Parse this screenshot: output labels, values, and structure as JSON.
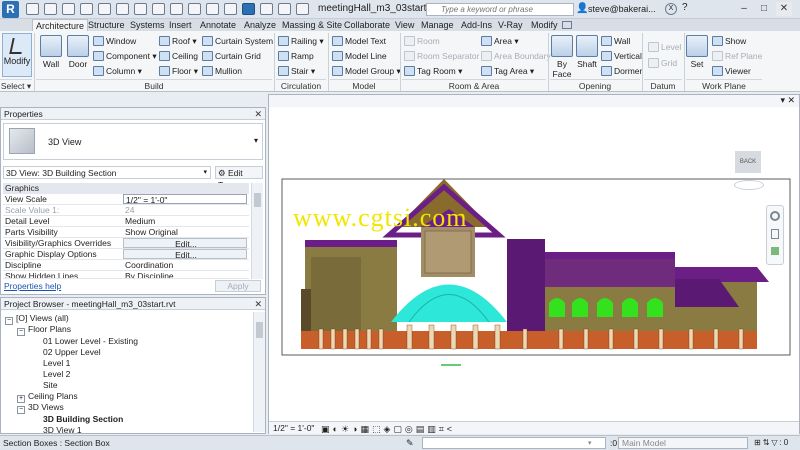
{
  "titlebar": {
    "doc_title": "meetingHall_m3_03start.rv...",
    "search_placeholder": "Type a keyword or phrase",
    "user": "steve@bakerai..."
  },
  "tabs": [
    "Architecture",
    "Structure",
    "Systems",
    "Insert",
    "Annotate",
    "Analyze",
    "Massing & Site",
    "Collaborate",
    "View",
    "Manage",
    "Add-Ins",
    "V-Ray",
    "Modify"
  ],
  "ribbon": {
    "modify": "Modify",
    "select": "Select",
    "wall": "Wall",
    "door": "Door",
    "window": "Window",
    "component": "Component",
    "column": "Column",
    "roof": "Roof",
    "ceiling": "Ceiling",
    "floor": "Floor",
    "curtain_system": "Curtain System",
    "curtain_grid": "Curtain Grid",
    "mullion": "Mullion",
    "build": "Build",
    "railing": "Railing",
    "ramp": "Ramp",
    "stair": "Stair",
    "circulation": "Circulation",
    "model_text": "Model Text",
    "model_line": "Model Line",
    "model_group": "Model Group",
    "model": "Model",
    "room": "Room",
    "room_separator": "Room Separator",
    "tag_room": "Tag Room",
    "area": "Area",
    "area_boundary": "Area Boundary",
    "tag_area": "Tag Area",
    "room_area": "Room & Area",
    "by_face": "By Face",
    "shaft": "Shaft",
    "wall_op": "Wall",
    "vertical": "Vertical",
    "dormer": "Dormer",
    "opening": "Opening",
    "level": "Level",
    "grid": "Grid",
    "datum": "Datum",
    "set": "Set",
    "show": "Show",
    "ref_plane": "Ref Plane",
    "viewer": "Viewer",
    "work_plane": "Work Plane"
  },
  "properties": {
    "title": "Properties",
    "type_name": "3D View",
    "view_selector": "3D View: 3D Building Section",
    "edit_type": "Edit Type",
    "group": "Graphics",
    "rows": [
      {
        "k": "View Scale",
        "v": "1/2\" = 1'-0\""
      },
      {
        "k": "Scale Value    1:",
        "v": "24"
      },
      {
        "k": "Detail Level",
        "v": "Medium"
      },
      {
        "k": "Parts Visibility",
        "v": "Show Original"
      },
      {
        "k": "Visibility/Graphics Overrides",
        "v": "Edit..."
      },
      {
        "k": "Graphic Display Options",
        "v": "Edit..."
      },
      {
        "k": "Discipline",
        "v": "Coordination"
      },
      {
        "k": "Show Hidden Lines",
        "v": "By Discipline"
      }
    ],
    "help": "Properties help",
    "apply": "Apply"
  },
  "browser": {
    "title": "Project Browser - meetingHall_m3_03start.rvt",
    "views_all": "Views (all)",
    "floor_plans": "Floor Plans",
    "fp_items": [
      "01 Lower Level - Existing",
      "02 Upper Level",
      "Level 1",
      "Level 2",
      "Site"
    ],
    "ceiling_plans": "Ceiling Plans",
    "views_3d": "3D Views",
    "v3d_items": [
      "3D Building Section",
      "3D View 1"
    ]
  },
  "view": {
    "watermark": "www.cgtsi.com",
    "viewcube": "BACK",
    "scale": "1/2\" = 1'-0\""
  },
  "status": {
    "text": "Section Boxes : Section Box",
    "zero": ":0",
    "model": "Main Model"
  },
  "colors": {
    "roof_purple": "#6b1f86",
    "glass_green": "#33e21c",
    "dome_cyan": "#2de8d9",
    "brick_brown": "#c85f2b",
    "wall_olive": "#8a7b43",
    "tower_tan": "#a38d66",
    "watermark_yellow": "#f2e600"
  }
}
